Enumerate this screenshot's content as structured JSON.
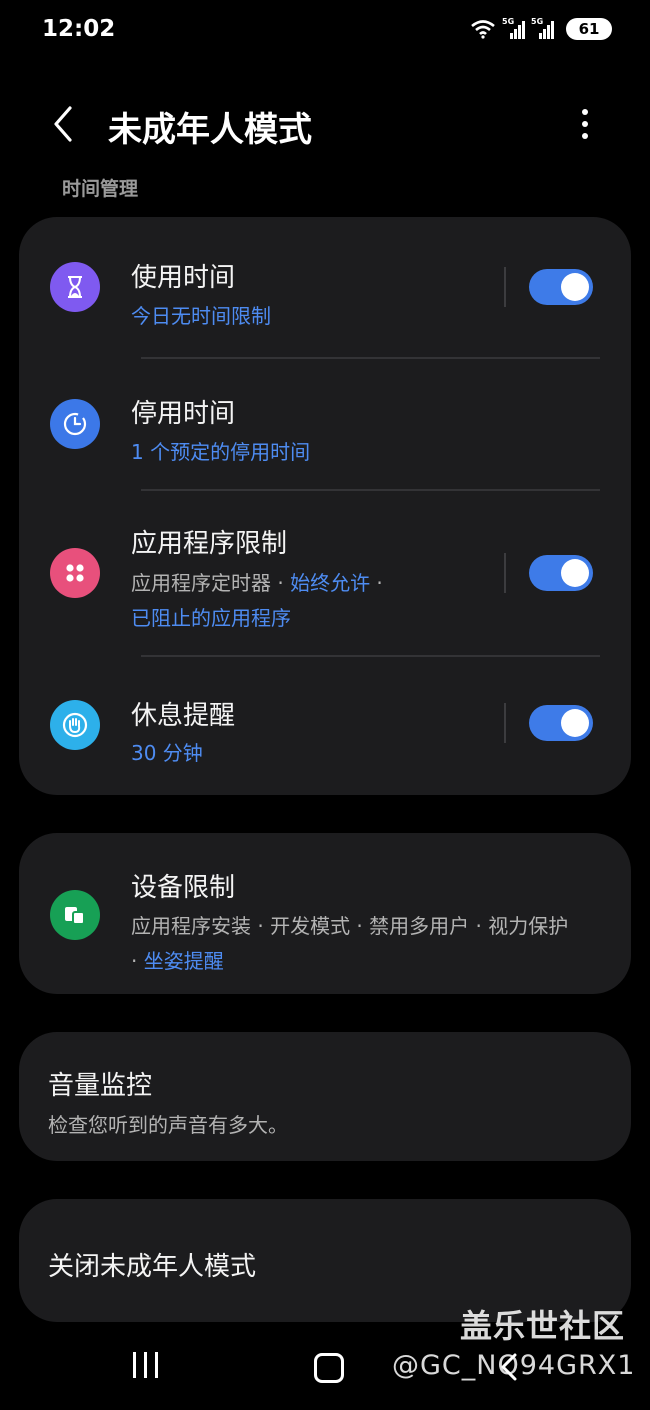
{
  "status_bar": {
    "time": "12:02",
    "network_1": "5G",
    "network_2": "5G",
    "battery": "61"
  },
  "header": {
    "title": "未成年人模式",
    "back_icon": "chevron-left-icon",
    "more_icon": "more-vertical-icon"
  },
  "section_label": "时间管理",
  "time_management": [
    {
      "title": "使用时间",
      "subtitle": "今日无时间限制",
      "icon": "hourglass-icon",
      "icon_color": "#7f5af0",
      "toggle": true
    },
    {
      "title": "停用时间",
      "subtitle": "1 个预定的停用时间",
      "icon": "clock-icon",
      "icon_color": "#3c78e8"
    },
    {
      "title": "应用程序限制",
      "subtitle_grey": "应用程序定时器",
      "subtitle_sep_1": " · ",
      "subtitle_blue": "始终允许",
      "subtitle_sep_2": " ·",
      "subtitle_line2": "已阻止的应用程序",
      "icon": "apps-grid-icon",
      "icon_color": "#e8507c",
      "toggle": true
    },
    {
      "title": "休息提醒",
      "subtitle": "30 分钟",
      "icon": "hand-stop-icon",
      "icon_color": "#2db0ea",
      "toggle": true
    }
  ],
  "device_restrictions": {
    "title": "设备限制",
    "subtitle_line1": "应用程序安装  · 开发模式  · 禁用多用户  · 视力保护",
    "subtitle_line2_sep": " · ",
    "subtitle_line2": "坐姿提醒",
    "icon": "devices-icon",
    "icon_color": "#17a055"
  },
  "volume_monitor": {
    "title": "音量监控",
    "subtitle": "检查您听到的声音有多大。"
  },
  "disable_mode": {
    "title": "关闭未成年人模式"
  },
  "nav": {
    "recent_icon": "recent-apps-icon",
    "home_icon": "home-icon",
    "back_icon": "back-icon"
  },
  "watermark": {
    "line1": "盖乐世社区",
    "line2": "@GC_NQ94GRX1"
  },
  "colors": {
    "accent": "#3e7be8",
    "link": "#4e8cf2",
    "card": "#1c1c1e",
    "background": "#000000"
  }
}
